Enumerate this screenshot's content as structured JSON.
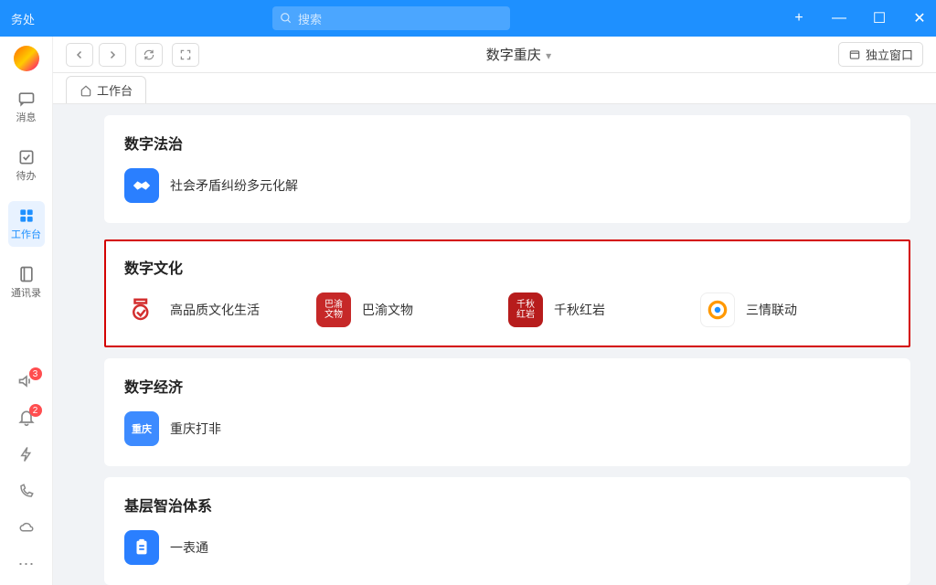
{
  "titlebar": {
    "left": "务处",
    "search_placeholder": "搜索"
  },
  "win": {
    "plus": "+",
    "min": "—",
    "max": "☐",
    "close": "✕"
  },
  "sidebar": {
    "items": [
      {
        "label": "消息"
      },
      {
        "label": "待办"
      },
      {
        "label": "工作台"
      },
      {
        "label": "通讯录"
      }
    ],
    "active_index": 2,
    "badge1": "3",
    "badge2": "2"
  },
  "topbar": {
    "title": "数字重庆",
    "indep": "独立窗口"
  },
  "tab": {
    "label": "工作台"
  },
  "sections": [
    {
      "title": "数字法治",
      "items": [
        {
          "label": "社会矛盾纠纷多元化解",
          "icon": "handshake"
        }
      ]
    },
    {
      "title": "数字文化",
      "highlight": true,
      "items": [
        {
          "label": "高品质文化生活",
          "icon": "cup-red"
        },
        {
          "label": "巴渝文物",
          "icon": "seal-bayu"
        },
        {
          "label": "千秋红岩",
          "icon": "seal-hongyan"
        },
        {
          "label": "三情联动",
          "icon": "ring"
        }
      ]
    },
    {
      "title": "数字经济",
      "items": [
        {
          "label": "重庆打非",
          "icon": "cq"
        }
      ]
    },
    {
      "title": "基层智治体系",
      "items": [
        {
          "label": "一表通",
          "icon": "clipboard"
        }
      ]
    }
  ]
}
